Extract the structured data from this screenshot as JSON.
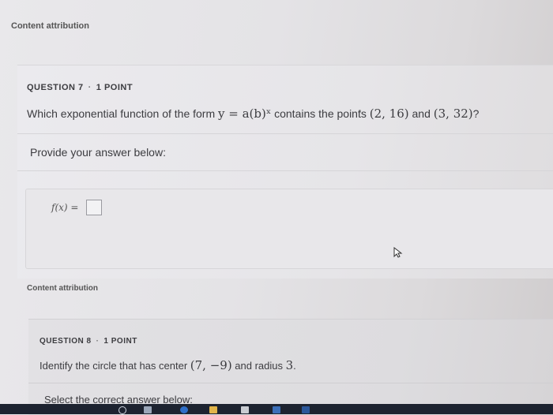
{
  "content_attribution_top": "Content attribution",
  "q7": {
    "number": "QUESTION 7",
    "separator": "·",
    "points": "1 POINT",
    "text_before": "Which exponential function of the form ",
    "math_form": "y = a(b)ˣ",
    "text_mid": " contains the points ",
    "point1": "(2, 16)",
    "text_and": " and ",
    "point2": "(3, 32)",
    "text_end": "?",
    "prompt": "Provide your answer below:",
    "answer_label": "f(x) ="
  },
  "content_attribution_bottom": "Content attribution",
  "q8": {
    "number": "QUESTION 8",
    "separator": "·",
    "points": "1 POINT",
    "text_before": "Identify the circle that has center ",
    "center": "(7, −9)",
    "text_mid": " and radius ",
    "radius": "3",
    "text_end": ".",
    "prompt": "Select the correct answer below:"
  },
  "taskbar": {
    "icons": [
      "browser-icon",
      "task-view-icon",
      "edge-icon",
      "folder-icon",
      "store-icon",
      "mail-icon",
      "word-icon"
    ]
  }
}
